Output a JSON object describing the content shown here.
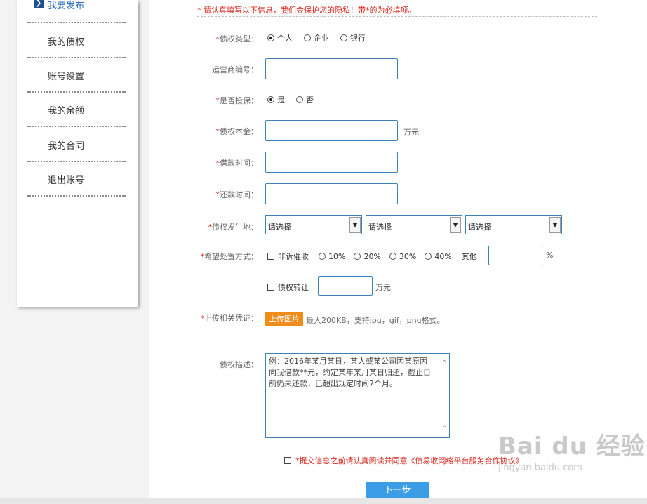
{
  "sidebar": {
    "items": [
      {
        "label": "我要发布",
        "active": true
      },
      {
        "label": "我的债权"
      },
      {
        "label": "账号设置"
      },
      {
        "label": "我的余额"
      },
      {
        "label": "我的合同"
      },
      {
        "label": "退出账号"
      }
    ]
  },
  "form": {
    "notice": "* 请认真填写以下信息，我们会保护您的隐私！带*的为必填项。",
    "required_mark": "*",
    "claim_type": {
      "label": "债权类型：",
      "options": [
        "个人",
        "企业",
        "银行"
      ],
      "selected": "个人"
    },
    "operator_no": {
      "label": "运营商编号："
    },
    "insured": {
      "label": "是否投保：",
      "options": [
        "是",
        "否"
      ],
      "selected": "是"
    },
    "principal": {
      "label": "债权本金：",
      "unit": "万元"
    },
    "loan_date": {
      "label": "借款时间："
    },
    "repay_date": {
      "label": "还款时间："
    },
    "location": {
      "label": "债权发生地：",
      "selects": [
        "请选择",
        "请选择",
        "请选择"
      ]
    },
    "disposal": {
      "label": "希望处置方式：",
      "checkbox1": "非诉催收",
      "rates": [
        "10%",
        "20%",
        "30%",
        "40%"
      ],
      "other_label": "其他",
      "other_unit": "%",
      "checkbox2": "债权转让",
      "transfer_unit": "万元"
    },
    "upload": {
      "label": "上传相关凭证：",
      "button": "上传图片",
      "note": "最大200KB，支持jpg，gif，png格式。"
    },
    "description": {
      "label": "债权描述：",
      "placeholder": "例：2016年某月某日，某人或某公司因某原因向我借款**元，约定某年某月某日归还，截止目前仍未还款，已超出规定时间7个月。"
    },
    "agreement": "*提交信息之前请认真阅读并同意《债易收网络平台服务合作协议》",
    "next_button": "下一步"
  },
  "watermark": {
    "brand": "Bai du 经验",
    "url": "jingyan.baidu.com"
  }
}
